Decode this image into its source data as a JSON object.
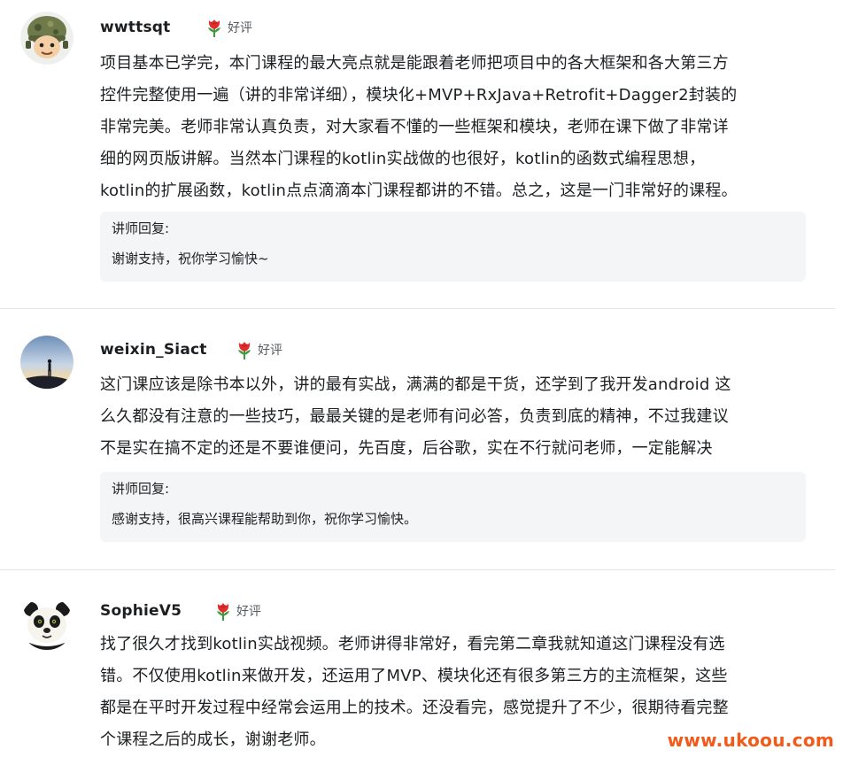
{
  "reviews": [
    {
      "username": "wwttsqt",
      "avatar": "soldier-avatar-icon",
      "rating_label": "好评",
      "content": "项目基本已学完，本门课程的最大亮点就是能跟着老师把项目中的各大框架和各大第三方控件完整使用一遍（讲的非常详细），模块化+MVP+RxJava+Retrofit+Dagger2封装的非常完美。老师非常认真负责，对大家看不懂的一些框架和模块，老师在课下做了非常详细的网页版讲解。当然本门课程的kotlin实战做的也很好，kotlin的函数式编程思想，kotlin的扩展函数，kotlin点点滴滴本门课程都讲的不错。总之，这是一门非常好的课程。",
      "content_lines": [
        "项目基本已学完，本门课程的最大亮点就是能跟着老师把项目中的各大框架和各大第三方",
        "控件完整使用一遍（讲的非常详细），模块化+MVP+RxJava+Retrofit+Dagger2封装的",
        "非常完美。老师非常认真负责，对大家看不懂的一些框架和模块，老师在课下做了非常详",
        "细的网页版讲解。当然本门课程的kotlin实战做的也很好，kotlin的函数式编程思想，",
        "kotlin的扩展函数，kotlin点点滴滴本门课程都讲的不错。总之，这是一门非常好的课程。"
      ],
      "reply_title": "讲师回复:",
      "reply_text": "谢谢支持，祝你学习愉快~"
    },
    {
      "username": "weixin_Siact",
      "avatar": "silhouette-avatar-icon",
      "rating_label": "好评",
      "content_lines": [
        "这门课应该是除书本以外，讲的最有实战，满满的都是干货，还学到了我开发android 这",
        "么久都没有注意的一些技巧，最最关键的是老师有问必答，负责到底的精神，不过我建议",
        "不是实在搞不定的还是不要谁便问，先百度，后谷歌，实在不行就问老师，一定能解决"
      ],
      "reply_title": "讲师回复:",
      "reply_text": "感谢支持，很高兴课程能帮助到你，祝你学习愉快。"
    },
    {
      "username": "SophieV5",
      "avatar": "panda-avatar-icon",
      "rating_label": "好评",
      "content_lines": [
        "找了很久才找到kotlin实战视频。老师讲得非常好，看完第二章我就知道这门课程没有选",
        "错。不仅使用kotlin来做开发，还运用了MVP、模块化还有很多第三方的主流框架，这些",
        "都是在平时开发过程中经常会运用上的技术。还没看完，感觉提升了不少，很期待看完整",
        "个课程之后的成长，谢谢老师。"
      ]
    }
  ],
  "watermark": "www.ukoou.com",
  "colors": {
    "text": "#1c1f21",
    "reply_bg": "#f3f5f6",
    "divider": "#e3e5e8",
    "rating_flower": "#e02d2d",
    "watermark": "#f25a1a"
  }
}
